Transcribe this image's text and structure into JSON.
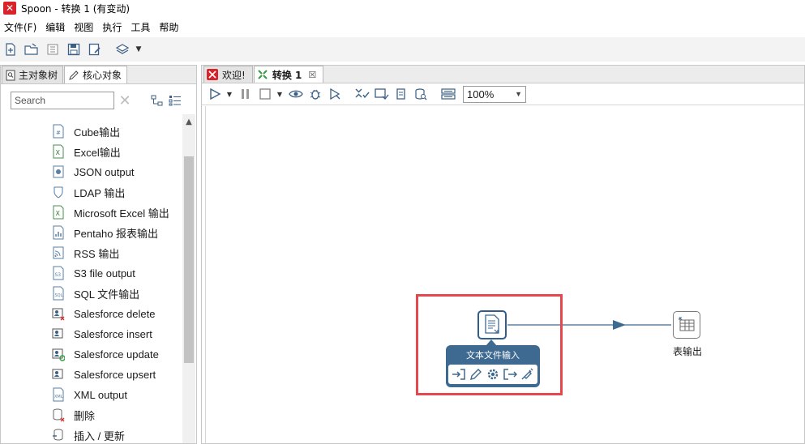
{
  "window": {
    "title": "Spoon - 转换 1 (有变动)"
  },
  "menu": [
    "文件(F)",
    "编辑",
    "视图",
    "执行",
    "工具",
    "帮助"
  ],
  "left_panel": {
    "tabs": [
      {
        "label": "主对象树",
        "active": false
      },
      {
        "label": "核心对象",
        "active": true
      }
    ],
    "search": {
      "placeholder": "Search",
      "value": ""
    },
    "steps": [
      {
        "label": "Cube输出",
        "icon": "cube-output-icon"
      },
      {
        "label": "Excel输出",
        "icon": "excel-output-icon"
      },
      {
        "label": "JSON output",
        "icon": "json-output-icon"
      },
      {
        "label": "LDAP 输出",
        "icon": "ldap-output-icon"
      },
      {
        "label": "Microsoft Excel 输出",
        "icon": "ms-excel-output-icon"
      },
      {
        "label": "Pentaho 报表输出",
        "icon": "pentaho-report-output-icon"
      },
      {
        "label": "RSS 输出",
        "icon": "rss-output-icon"
      },
      {
        "label": "S3 file output",
        "icon": "s3-file-output-icon"
      },
      {
        "label": "SQL 文件输出",
        "icon": "sql-file-output-icon"
      },
      {
        "label": "Salesforce delete",
        "icon": "salesforce-delete-icon"
      },
      {
        "label": "Salesforce insert",
        "icon": "salesforce-insert-icon"
      },
      {
        "label": "Salesforce update",
        "icon": "salesforce-update-icon"
      },
      {
        "label": "Salesforce upsert",
        "icon": "salesforce-upsert-icon"
      },
      {
        "label": "XML output",
        "icon": "xml-output-icon"
      },
      {
        "label": "删除",
        "icon": "delete-step-icon"
      },
      {
        "label": "插入 / 更新",
        "icon": "insert-update-icon"
      }
    ]
  },
  "doc_tabs": [
    {
      "label": "欢迎!",
      "active": false,
      "closable": false
    },
    {
      "label": "转换 1",
      "active": true,
      "closable": true,
      "close_glyph": "☒"
    }
  ],
  "canvas_toolbar": {
    "zoom": "100%"
  },
  "canvas": {
    "nodes": [
      {
        "name": "文本文件输入",
        "type": "text-file-input",
        "selected": true
      },
      {
        "name": "表输出",
        "type": "table-output",
        "selected": false
      }
    ],
    "hops": [
      {
        "from": "文本文件输入",
        "to": "表输出"
      }
    ]
  },
  "colors": {
    "highlight": "#e5474c",
    "node_selected": "#2f5e8e",
    "popup_bg": "#3e6a91",
    "app_icon": "#d8232a"
  }
}
